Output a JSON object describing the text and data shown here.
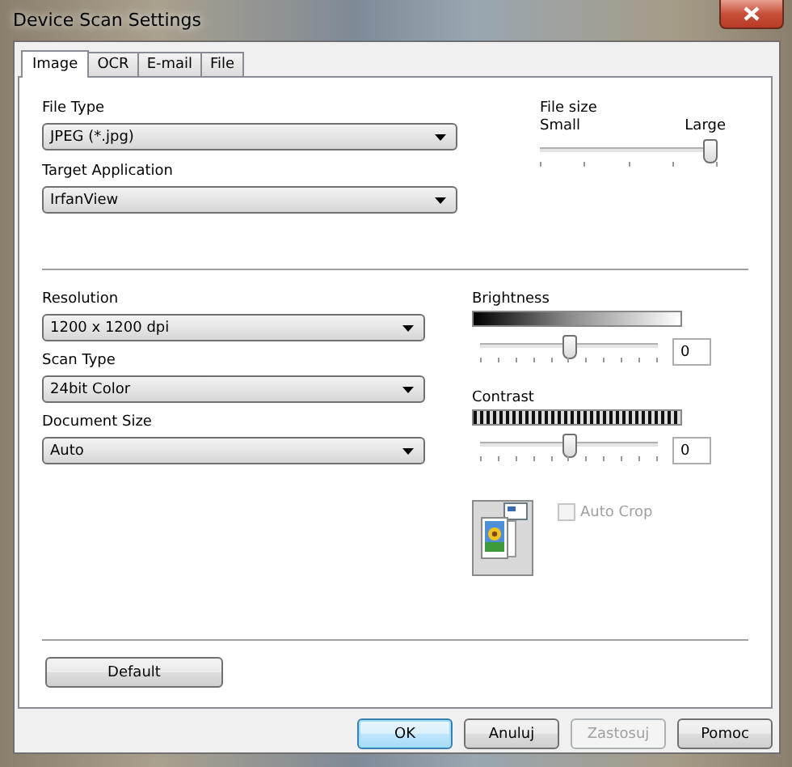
{
  "window": {
    "title": "Device Scan Settings"
  },
  "tabs": [
    {
      "label": "Image",
      "selected": true
    },
    {
      "label": "OCR",
      "selected": false
    },
    {
      "label": "E-mail",
      "selected": false
    },
    {
      "label": "File",
      "selected": false
    }
  ],
  "file_type": {
    "label": "File Type",
    "value": "JPEG (*.jpg)"
  },
  "target_application": {
    "label": "Target Application",
    "value": "IrfanView"
  },
  "file_size": {
    "label": "File size",
    "min_label": "Small",
    "max_label": "Large",
    "level": 1.0
  },
  "resolution": {
    "label": "Resolution",
    "value": "1200 x 1200 dpi"
  },
  "scan_type": {
    "label": "Scan Type",
    "value": "24bit Color"
  },
  "document_size": {
    "label": "Document Size",
    "value": "Auto"
  },
  "brightness": {
    "label": "Brightness",
    "level": 0.5,
    "value": "0"
  },
  "contrast": {
    "label": "Contrast",
    "level": 0.5,
    "value": "0"
  },
  "auto_crop": {
    "label": "Auto Crop",
    "checked": false,
    "disabled": true
  },
  "default_button": {
    "label": "Default"
  },
  "buttons": [
    {
      "label": "OK",
      "default": true,
      "disabled": false
    },
    {
      "label": "Anuluj",
      "default": false,
      "disabled": false
    },
    {
      "label": "Zastosuj",
      "default": false,
      "disabled": true
    },
    {
      "label": "Pomoc",
      "default": false,
      "disabled": false
    }
  ]
}
